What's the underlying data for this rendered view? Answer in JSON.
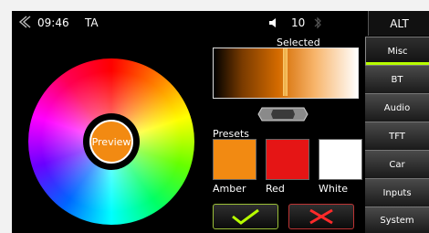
{
  "topbar": {
    "time": "09:46",
    "ta": "TA",
    "volume": "10",
    "icons": [
      "back-icon",
      "speaker-icon",
      "bluetooth-icon"
    ]
  },
  "alt": "ALT",
  "sidebar": {
    "items": [
      {
        "label": "Misc",
        "active": true
      },
      {
        "label": "BT",
        "active": false
      },
      {
        "label": "Audio",
        "active": false
      },
      {
        "label": "TFT",
        "active": false
      },
      {
        "label": "Car",
        "active": false
      },
      {
        "label": "Inputs",
        "active": false
      },
      {
        "label": "System",
        "active": false
      }
    ]
  },
  "wheel": {
    "preview_label": "Preview",
    "preview_color": "#f28a12"
  },
  "selected": {
    "label": "Selected",
    "gradient": [
      "#000000",
      "#7a3b00",
      "#d46b00",
      "#f7b46a",
      "#ffffff"
    ],
    "marker_position": 0.5
  },
  "presets": {
    "label": "Presets",
    "items": [
      {
        "name": "Amber",
        "color": "#f28a12"
      },
      {
        "name": "Red",
        "color": "#e51515"
      },
      {
        "name": "White",
        "color": "#ffffff"
      }
    ]
  },
  "buttons": {
    "ok_icon": "checkmark-icon",
    "cancel_icon": "x-icon",
    "ok_color": "#b7ff00",
    "cancel_color": "#ff2a2a"
  }
}
